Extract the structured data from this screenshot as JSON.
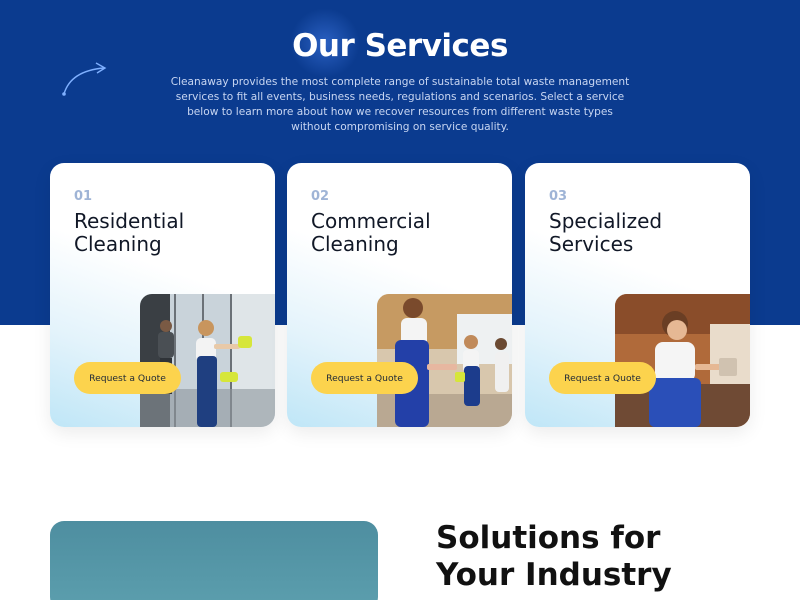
{
  "services": {
    "title": "Our Services",
    "intro": "Cleanaway provides the most complete range of sustainable total waste management services to fit all events, business needs, regulations and scenarios. Select a service below to learn more about how we recover resources from different waste types without compromising on service quality.",
    "cards": [
      {
        "number": "01",
        "title": "Residential\nCleaning",
        "button_label": "Request a Quote"
      },
      {
        "number": "02",
        "title": "Commercial\nCleaning",
        "button_label": "Request a Quote"
      },
      {
        "number": "03",
        "title": "Specialized\nServices",
        "button_label": "Request a Quote"
      }
    ]
  },
  "solutions": {
    "heading": "Solutions for\nYour Industry"
  },
  "colors": {
    "hero_background": "#0b3b8f",
    "button_yellow": "#fcd34d",
    "number_muted": "#9fb4d6"
  },
  "icons": {
    "decorative_arrow": "curved-arrow-icon"
  }
}
